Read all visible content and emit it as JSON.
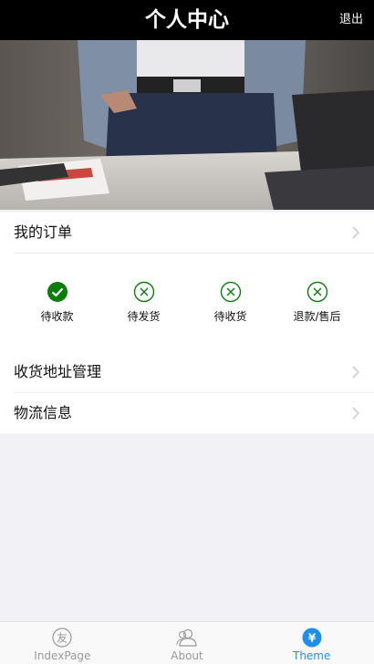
{
  "header": {
    "title": "个人中心",
    "logout_label": "退出"
  },
  "orders": {
    "title": "我的订单",
    "statuses": [
      {
        "label": "待收款",
        "state": "checked"
      },
      {
        "label": "待发货",
        "state": "cross"
      },
      {
        "label": "待收货",
        "state": "cross"
      },
      {
        "label": "退款/售后",
        "state": "cross"
      }
    ]
  },
  "menu": {
    "address_label": "收货地址管理",
    "logistics_label": "物流信息"
  },
  "tabbar": {
    "tabs": [
      {
        "label": "IndexPage",
        "icon": "friend-circle-icon"
      },
      {
        "label": "About",
        "icon": "people-icon"
      },
      {
        "label": "Theme",
        "icon": "yen-icon",
        "active": true
      }
    ]
  },
  "colors": {
    "accent": "#1e8ff1",
    "success": "#0a7d0a",
    "header_bg": "#000000",
    "page_bg": "#f2f2f6"
  }
}
